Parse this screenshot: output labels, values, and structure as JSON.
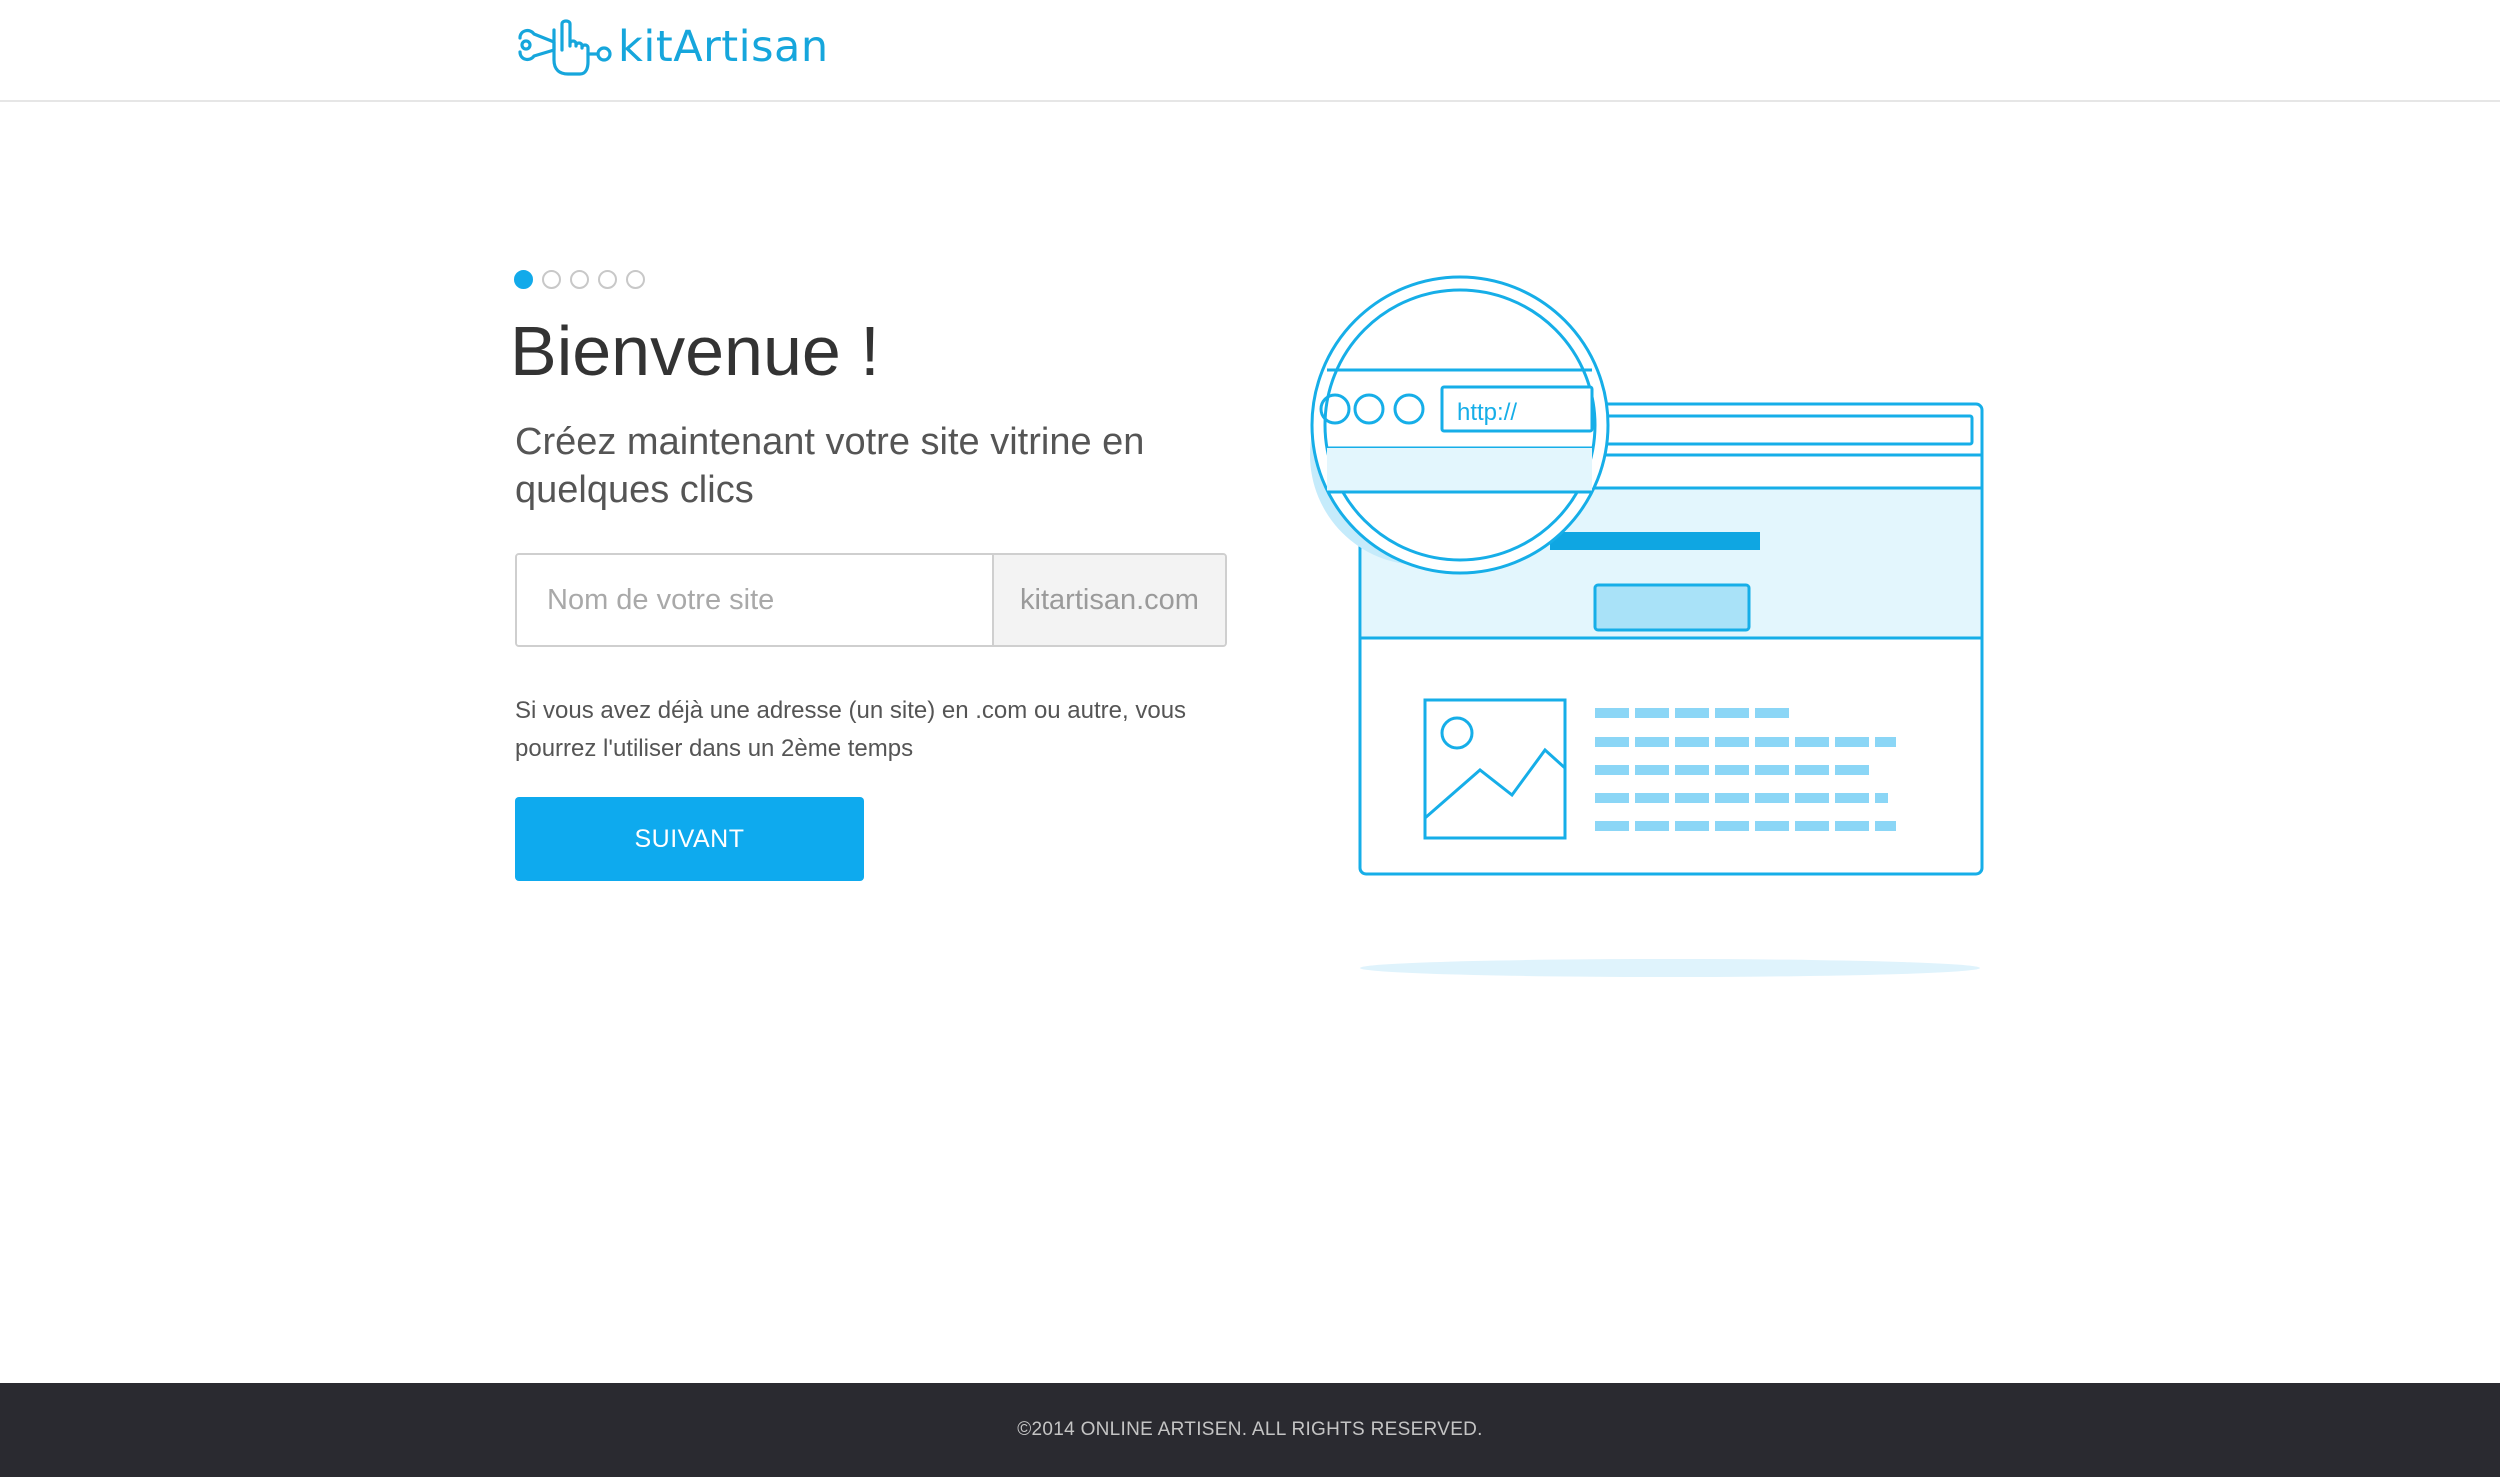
{
  "header": {
    "logo_text": "kitArtisan",
    "brand_color": "#16a6dc"
  },
  "steps": {
    "total": 5,
    "current": 1
  },
  "main": {
    "title": "Bienvenue !",
    "subtitle": "Créez maintenant votre site vitrine en quelques clics",
    "site_input": {
      "placeholder": "Nom de votre site",
      "value": ""
    },
    "domain_suffix": "kitartisan.com",
    "hint": "Si vous avez déjà une adresse (un site) en .com ou autre, vous pourrez l'utiliser dans un 2ème temps",
    "next_button_label": "SUIVANT",
    "accent_color": "#0eaaee"
  },
  "illustration": {
    "url_text": "http://"
  },
  "footer": {
    "copyright": "©2014 ONLINE ARTISEN. ALL RIGHTS RESERVED."
  }
}
